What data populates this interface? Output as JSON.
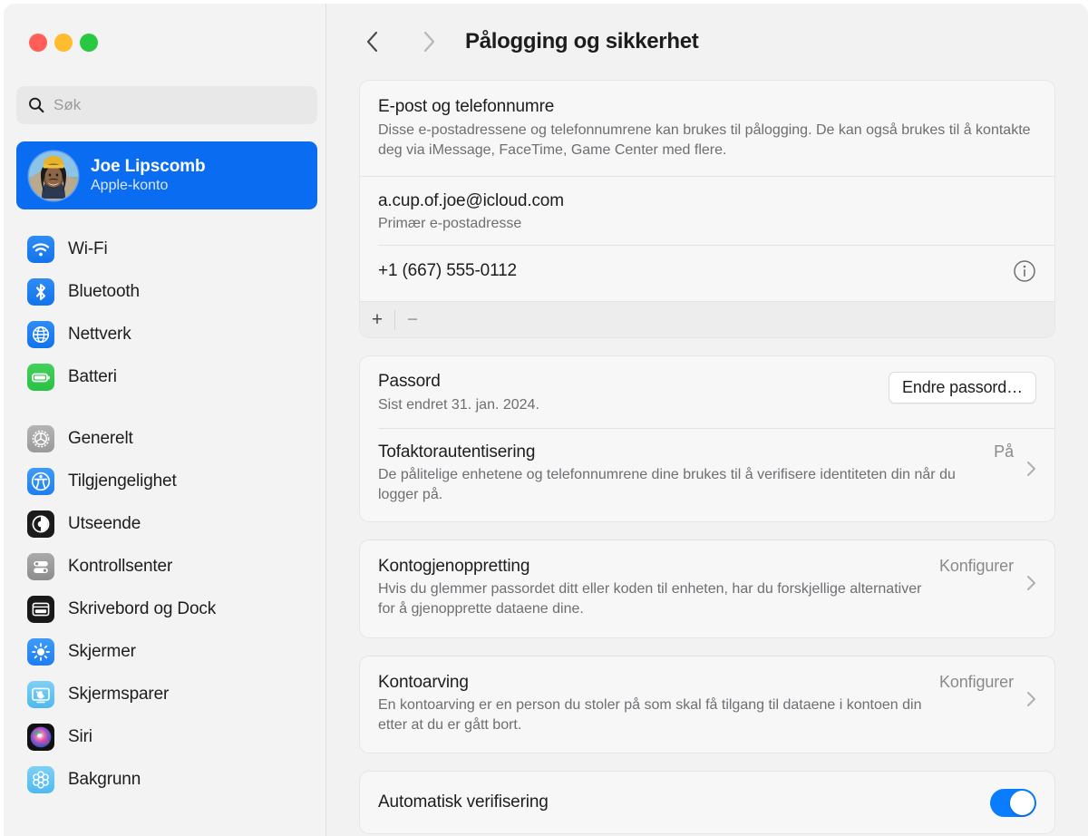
{
  "window": {
    "traffic_lights": {
      "close": "close",
      "minimize": "minimize",
      "zoom": "zoom"
    }
  },
  "sidebar": {
    "search": {
      "placeholder": "Søk",
      "value": ""
    },
    "account": {
      "name": "Joe Lipscomb",
      "subtitle": "Apple-konto"
    },
    "groups": [
      {
        "items": [
          {
            "label": "Wi-Fi",
            "icon": "wifi-icon"
          },
          {
            "label": "Bluetooth",
            "icon": "bluetooth-icon"
          },
          {
            "label": "Nettverk",
            "icon": "network-icon"
          },
          {
            "label": "Batteri",
            "icon": "battery-icon"
          }
        ]
      },
      {
        "items": [
          {
            "label": "Generelt",
            "icon": "gear-icon"
          },
          {
            "label": "Tilgjengelighet",
            "icon": "accessibility-icon"
          },
          {
            "label": "Utseende",
            "icon": "appearance-icon"
          },
          {
            "label": "Kontrollsenter",
            "icon": "control-center-icon"
          },
          {
            "label": "Skrivebord og Dock",
            "icon": "desktop-dock-icon"
          },
          {
            "label": "Skjermer",
            "icon": "displays-icon"
          },
          {
            "label": "Skjermsparer",
            "icon": "screensaver-icon"
          },
          {
            "label": "Siri",
            "icon": "siri-icon"
          },
          {
            "label": "Bakgrunn",
            "icon": "wallpaper-icon"
          }
        ]
      }
    ]
  },
  "toolbar": {
    "back_label": "Tilbake",
    "forward_label": "Fremover",
    "title": "Pålogging og sikkerhet"
  },
  "main": {
    "email_card": {
      "title": "E-post og telefonnumre",
      "description": "Disse e-postadressene og telefonnumrene kan brukes til pålogging. De kan også brukes til å kontakte deg via iMessage, FaceTime, Game Center med flere.",
      "entries": [
        {
          "value": "a.cup.of.joe@icloud.com",
          "sub": "Primær e-postadresse",
          "has_info": false
        },
        {
          "value": "+1 (667) 555-0112",
          "sub": "",
          "has_info": true
        }
      ],
      "add_label": "+",
      "remove_label": "−"
    },
    "password_card": {
      "password": {
        "title": "Passord",
        "sub": "Sist endret 31. jan. 2024.",
        "button": "Endre passord…"
      },
      "two_factor": {
        "title": "Tofaktorautentisering",
        "sub": "De pålitelige enhetene og telefonnumrene dine brukes til å verifisere identiteten din når du logger på.",
        "value": "På"
      }
    },
    "recovery_card": {
      "title": "Kontogjenoppretting",
      "sub": "Hvis du glemmer passordet ditt eller koden til enheten, har du forskjellige alternativer for å gjenopprette dataene dine.",
      "value": "Konfigurer"
    },
    "legacy_card": {
      "title": "Kontoarving",
      "sub": "En kontoarving er en person du stoler på som skal få tilgang til dataene i kontoen din etter at du er gått bort.",
      "value": "Konfigurer"
    },
    "auto_verify_card": {
      "title": "Automatisk verifisering",
      "toggle_state": "on"
    }
  },
  "colors": {
    "accent": "#0a6cf0",
    "toggle_on": "#0a7cff",
    "sidebar_bg": "#f3f3f3",
    "content_bg": "#f2f2f2",
    "card_bg": "#f7f7f7"
  }
}
